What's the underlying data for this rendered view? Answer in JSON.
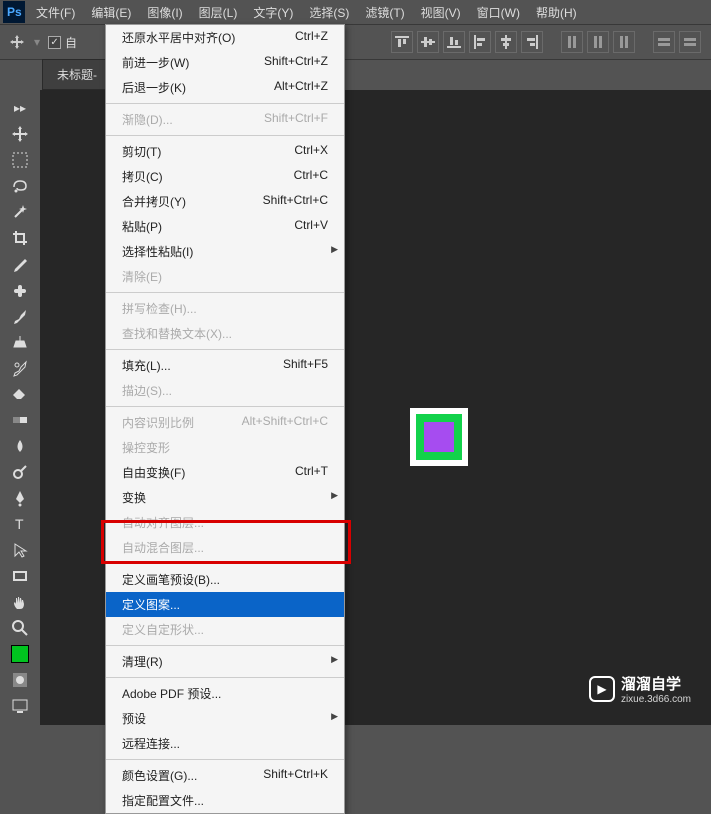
{
  "menubar": {
    "items": [
      "文件(F)",
      "编辑(E)",
      "图像(I)",
      "图层(L)",
      "文字(Y)",
      "选择(S)",
      "滤镜(T)",
      "视图(V)",
      "窗口(W)",
      "帮助(H)"
    ]
  },
  "optionsbar": {
    "auto_select_label": "自"
  },
  "tabbar": {
    "tab_label": "未标题-"
  },
  "dropdown": {
    "items": [
      {
        "type": "item",
        "label": "还原水平居中对齐(O)",
        "shortcut": "Ctrl+Z"
      },
      {
        "type": "item",
        "label": "前进一步(W)",
        "shortcut": "Shift+Ctrl+Z"
      },
      {
        "type": "item",
        "label": "后退一步(K)",
        "shortcut": "Alt+Ctrl+Z"
      },
      {
        "type": "sep"
      },
      {
        "type": "item",
        "label": "渐隐(D)...",
        "shortcut": "Shift+Ctrl+F",
        "disabled": true
      },
      {
        "type": "sep"
      },
      {
        "type": "item",
        "label": "剪切(T)",
        "shortcut": "Ctrl+X"
      },
      {
        "type": "item",
        "label": "拷贝(C)",
        "shortcut": "Ctrl+C"
      },
      {
        "type": "item",
        "label": "合并拷贝(Y)",
        "shortcut": "Shift+Ctrl+C"
      },
      {
        "type": "item",
        "label": "粘贴(P)",
        "shortcut": "Ctrl+V"
      },
      {
        "type": "item",
        "label": "选择性粘贴(I)",
        "shortcut": "",
        "submenu": true
      },
      {
        "type": "item",
        "label": "清除(E)",
        "shortcut": "",
        "disabled": true
      },
      {
        "type": "sep"
      },
      {
        "type": "item",
        "label": "拼写检查(H)...",
        "shortcut": "",
        "disabled": true
      },
      {
        "type": "item",
        "label": "查找和替换文本(X)...",
        "shortcut": "",
        "disabled": true
      },
      {
        "type": "sep"
      },
      {
        "type": "item",
        "label": "填充(L)...",
        "shortcut": "Shift+F5"
      },
      {
        "type": "item",
        "label": "描边(S)...",
        "shortcut": "",
        "disabled": true
      },
      {
        "type": "sep"
      },
      {
        "type": "item",
        "label": "内容识别比例",
        "shortcut": "Alt+Shift+Ctrl+C",
        "disabled": true
      },
      {
        "type": "item",
        "label": "操控变形",
        "shortcut": "",
        "disabled": true
      },
      {
        "type": "item",
        "label": "自由变换(F)",
        "shortcut": "Ctrl+T"
      },
      {
        "type": "item",
        "label": "变换",
        "shortcut": "",
        "submenu": true
      },
      {
        "type": "item",
        "label": "自动对齐图层...",
        "shortcut": "",
        "disabled": true
      },
      {
        "type": "item",
        "label": "自动混合图层...",
        "shortcut": "",
        "disabled": true
      },
      {
        "type": "sep"
      },
      {
        "type": "item",
        "label": "定义画笔预设(B)...",
        "shortcut": ""
      },
      {
        "type": "item",
        "label": "定义图案...",
        "shortcut": "",
        "highlight": true
      },
      {
        "type": "item",
        "label": "定义自定形状...",
        "shortcut": "",
        "disabled": true
      },
      {
        "type": "sep"
      },
      {
        "type": "item",
        "label": "清理(R)",
        "shortcut": "",
        "submenu": true
      },
      {
        "type": "sep"
      },
      {
        "type": "item",
        "label": "Adobe PDF 预设...",
        "shortcut": ""
      },
      {
        "type": "item",
        "label": "预设",
        "shortcut": "",
        "submenu": true
      },
      {
        "type": "item",
        "label": "远程连接...",
        "shortcut": ""
      },
      {
        "type": "sep"
      },
      {
        "type": "item",
        "label": "颜色设置(G)...",
        "shortcut": "Shift+Ctrl+K"
      },
      {
        "type": "item",
        "label": "指定配置文件...",
        "shortcut": ""
      }
    ]
  },
  "watermark": {
    "text": "溜溜自学",
    "url": "zixue.3d66.com"
  }
}
